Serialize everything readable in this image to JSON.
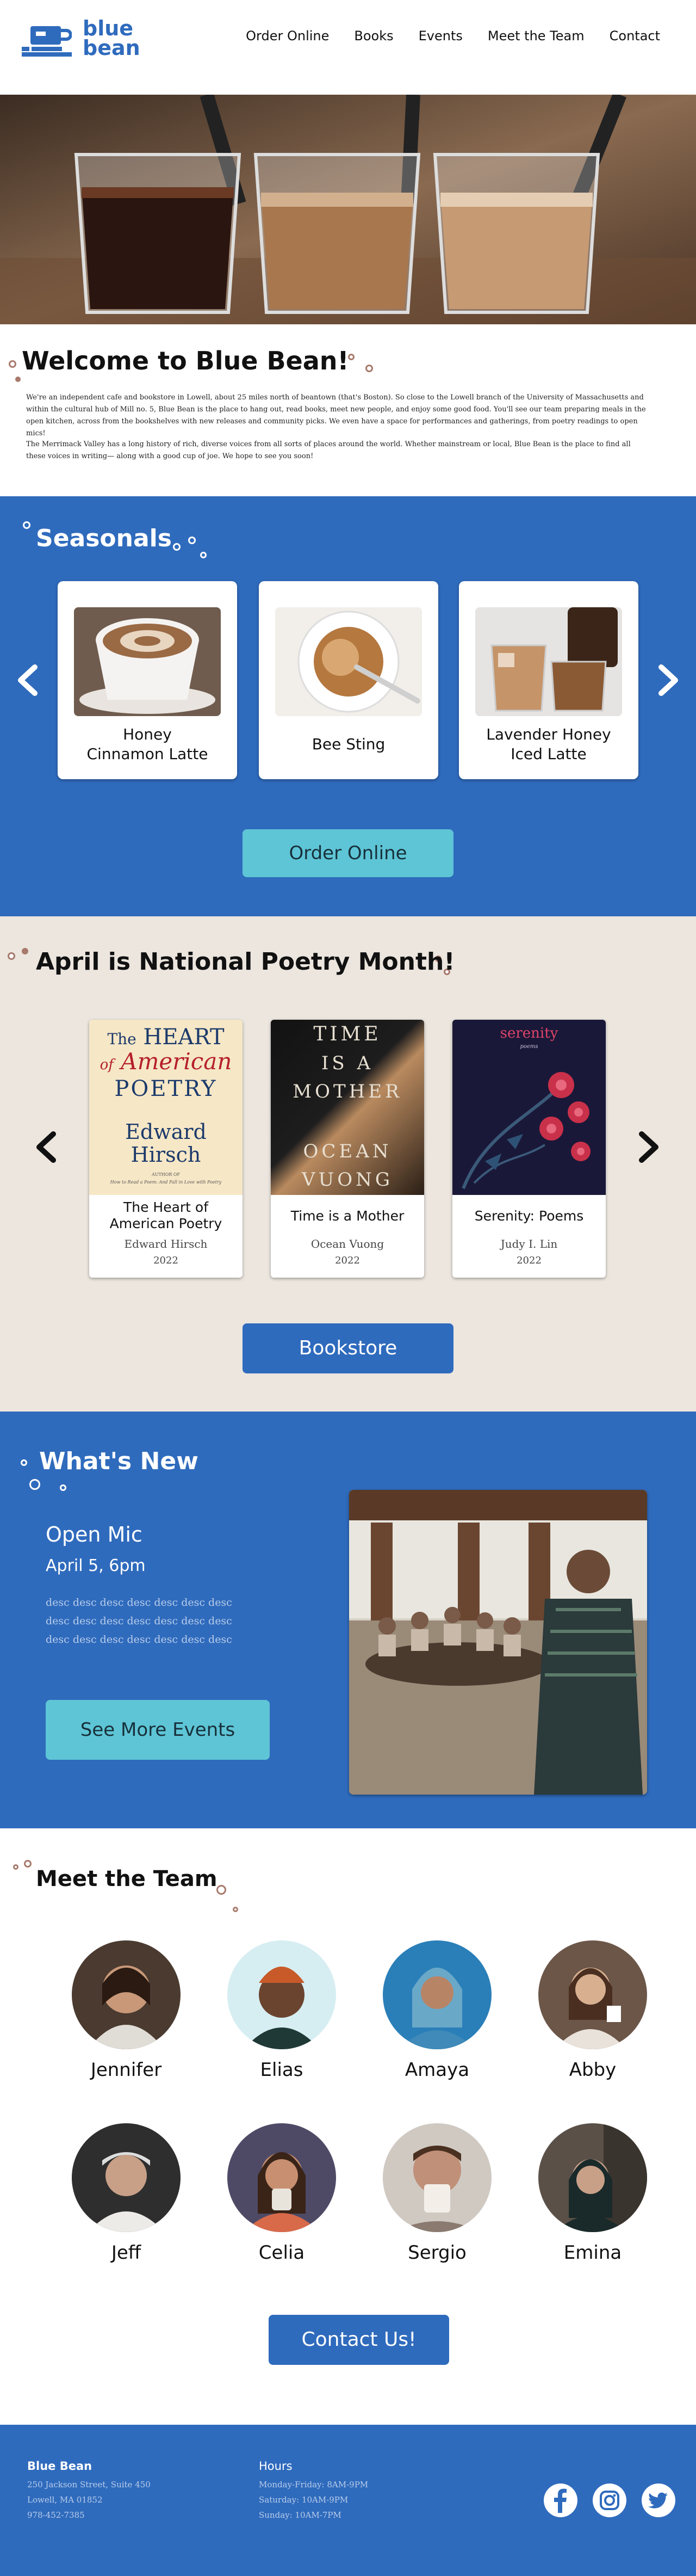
{
  "brand": {
    "name_line1": "blue",
    "name_line2": "bean",
    "color": "#2f6bbd"
  },
  "nav": [
    "Order Online",
    "Books",
    "Events",
    "Meet the Team",
    "Contact"
  ],
  "welcome": {
    "title": "Welcome to Blue Bean!",
    "p1": "We're an independent cafe and bookstore in Lowell, about 25 miles north of beantown (that's Boston). So close to the Lowell branch of the University of Massachusetts and within the cultural hub of Mill no. 5, Blue Bean is the place to hang out, read books, meet new people, and enjoy some good food. You'll see our team preparing meals in the open kitchen, across from the bookshelves with new releases and community picks. We even have a space for performances and gatherings, from poetry readings to open mics!",
    "p2": "The Merrimack Valley has a long history of rich, diverse voices from all sorts of places around the world. Whether mainstream or local, Blue Bean is the place to find all these voices in writing— along with a good cup of joe. We hope to see you soon!"
  },
  "seasonals": {
    "title": "Seasonals",
    "items": [
      {
        "line1": "Honey",
        "line2": "Cinnamon Latte",
        "icon": "latte-art-cup-photo"
      },
      {
        "line1": "Bee Sting",
        "line2": "",
        "icon": "coffee-spoon-photo"
      },
      {
        "line1": "Lavender Honey",
        "line2": "Iced Latte",
        "icon": "iced-latte-photo"
      }
    ],
    "button": "Order Online"
  },
  "poetry": {
    "title": "April is National Poetry Month!",
    "books": [
      {
        "title_line1": "The Heart of",
        "title_line2": "American Poetry",
        "author": "Edward Hirsch",
        "year": "2022",
        "cover": {
          "c1": "The",
          "c2": "HEART",
          "c3": "of",
          "c4": "American",
          "c5": "POETRY",
          "c6": "Edward",
          "c7": "Hirsch",
          "c8": "AUTHOR OF",
          "c9": "How to Read a Poem: And Fall in Love with Poetry"
        }
      },
      {
        "title_line1": "Time is a Mother",
        "title_line2": "",
        "author": "Ocean Vuong",
        "year": "2022",
        "cover": {
          "c1": "TIME",
          "c2": "IS A",
          "c3": "MOTHER",
          "c4": "OCEAN",
          "c5": "VUONG"
        }
      },
      {
        "title_line1": "Serenity: Poems",
        "title_line2": "",
        "author": "Judy I. Lin",
        "year": "2022",
        "cover": {
          "c1": "serenity",
          "c2": "poems"
        }
      }
    ],
    "button": "Bookstore"
  },
  "whatsnew": {
    "title": "What's New",
    "event_title": "Open Mic",
    "event_date": "April 5, 6pm",
    "desc1": "desc desc desc desc desc desc desc",
    "desc2": "desc desc desc desc desc desc desc",
    "desc3": "desc desc desc desc desc desc desc",
    "button": "See More Events"
  },
  "team": {
    "title": "Meet the Team",
    "members": [
      "Jennifer",
      "Elias",
      "Amaya",
      "Abby",
      "Jeff",
      "Celia",
      "Sergio",
      "Emina"
    ],
    "button": "Contact Us!"
  },
  "footer": {
    "name": "Blue Bean",
    "address1": "250 Jackson Street, Suite 450",
    "address2": "Lowell, MA 01852",
    "phone": "978-452-7385",
    "hours_title": "Hours",
    "hours1": "Monday-Friday: 8AM-9PM",
    "hours2": "Saturday: 10AM-9PM",
    "hours3": "Sunday: 10AM-7PM",
    "social": [
      "facebook-icon",
      "instagram-icon",
      "twitter-icon"
    ]
  },
  "colors": {
    "blue": "#2f6bbd",
    "teal_button": "#5ec5d6",
    "beige": "#ece6df",
    "dot_border": "#a87a6c"
  }
}
